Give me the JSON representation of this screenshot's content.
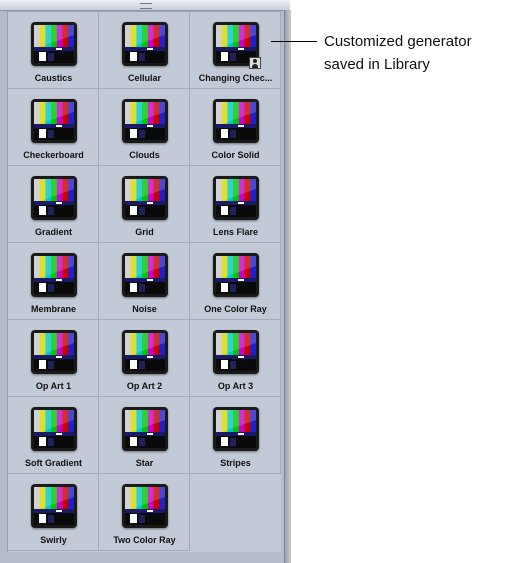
{
  "browser": {
    "items": [
      {
        "label": "Caustics",
        "icon": "color-bars-thumbnail"
      },
      {
        "label": "Cellular",
        "icon": "color-bars-thumbnail"
      },
      {
        "label": "Changing Chec...",
        "icon": "color-bars-thumbnail",
        "badge": "user-library-icon"
      },
      {
        "label": "Checkerboard",
        "icon": "color-bars-thumbnail"
      },
      {
        "label": "Clouds",
        "icon": "color-bars-thumbnail"
      },
      {
        "label": "Color Solid",
        "icon": "color-bars-thumbnail"
      },
      {
        "label": "Gradient",
        "icon": "color-bars-thumbnail"
      },
      {
        "label": "Grid",
        "icon": "color-bars-thumbnail"
      },
      {
        "label": "Lens Flare",
        "icon": "color-bars-thumbnail"
      },
      {
        "label": "Membrane",
        "icon": "color-bars-thumbnail"
      },
      {
        "label": "Noise",
        "icon": "color-bars-thumbnail"
      },
      {
        "label": "One Color Ray",
        "icon": "color-bars-thumbnail"
      },
      {
        "label": "Op Art 1",
        "icon": "color-bars-thumbnail"
      },
      {
        "label": "Op Art 2",
        "icon": "color-bars-thumbnail"
      },
      {
        "label": "Op Art 3",
        "icon": "color-bars-thumbnail"
      },
      {
        "label": "Soft Gradient",
        "icon": "color-bars-thumbnail"
      },
      {
        "label": "Star",
        "icon": "color-bars-thumbnail"
      },
      {
        "label": "Stripes",
        "icon": "color-bars-thumbnail"
      },
      {
        "label": "Swirly",
        "icon": "color-bars-thumbnail"
      },
      {
        "label": "Two Color Ray",
        "icon": "color-bars-thumbnail"
      }
    ]
  },
  "callout": {
    "line1": "Customized generator",
    "line2": "saved in Library"
  },
  "colors": {
    "panel_bg": "#c3cad7",
    "bars": [
      "#c8c8c8",
      "#d8d800",
      "#00c8c8",
      "#00c800",
      "#c800c8",
      "#c80000",
      "#2020c8"
    ]
  }
}
